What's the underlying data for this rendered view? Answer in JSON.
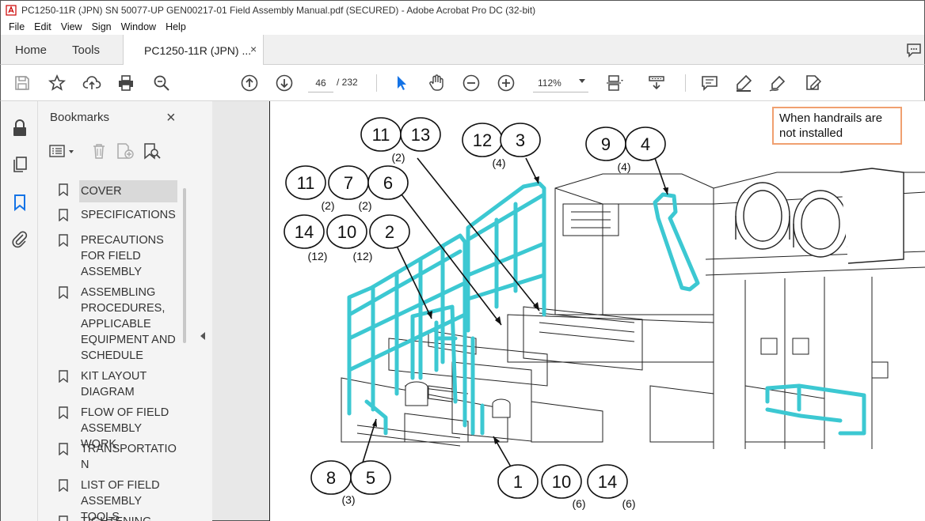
{
  "window": {
    "title": "PC1250-11R (JPN) SN 50077-UP GEN00217-01 Field Assembly Manual.pdf (SECURED) - Adobe Acrobat Pro DC (32-bit)"
  },
  "menu": [
    "File",
    "Edit",
    "View",
    "Sign",
    "Window",
    "Help"
  ],
  "tabs": {
    "home": "Home",
    "tools": "Tools",
    "document": "PC1250-11R (JPN) ...",
    "close_glyph": "×"
  },
  "toolbar": {
    "page_current": "46",
    "page_total": "/ 232",
    "zoom": "112%"
  },
  "bookmarks": {
    "title": "Bookmarks",
    "close_glyph": "×",
    "items": [
      {
        "label": "COVER",
        "selected": true
      },
      {
        "label": "SPECIFICATIONS"
      },
      {
        "label": "PRECAUTIONS FOR FIELD ASSEMBLY"
      },
      {
        "label": "ASSEMBLING PROCEDURES, APPLICABLE EQUIPMENT AND SCHEDULE"
      },
      {
        "label": "KIT LAYOUT DIAGRAM"
      },
      {
        "label": "FLOW OF FIELD ASSEMBLY WORK"
      },
      {
        "label": "TRANSPORTATIO N"
      },
      {
        "label": "LIST OF FIELD ASSEMBLY TOOLS"
      },
      {
        "label": "TIGHTENING"
      }
    ]
  },
  "document": {
    "note": "When handrails are not installed",
    "callouts": [
      {
        "numbers": [
          "11",
          "13"
        ],
        "qty": "(2)"
      },
      {
        "numbers": [
          "12",
          "3"
        ],
        "qty": "(4)"
      },
      {
        "numbers": [
          "9",
          "4"
        ],
        "qty": "(4)"
      },
      {
        "numbers": [
          "11",
          "7",
          "6"
        ],
        "qty": [
          "(2)",
          "(2)"
        ]
      },
      {
        "numbers": [
          "14",
          "10",
          "2"
        ],
        "qty": [
          "(12)",
          "(12)"
        ]
      },
      {
        "numbers": [
          "8",
          "5"
        ],
        "qty": "(3)"
      },
      {
        "numbers": [
          "1",
          "10",
          "14"
        ],
        "qty": [
          "(6)",
          "(6)"
        ]
      }
    ],
    "accent_color": "#3cc8d2"
  }
}
